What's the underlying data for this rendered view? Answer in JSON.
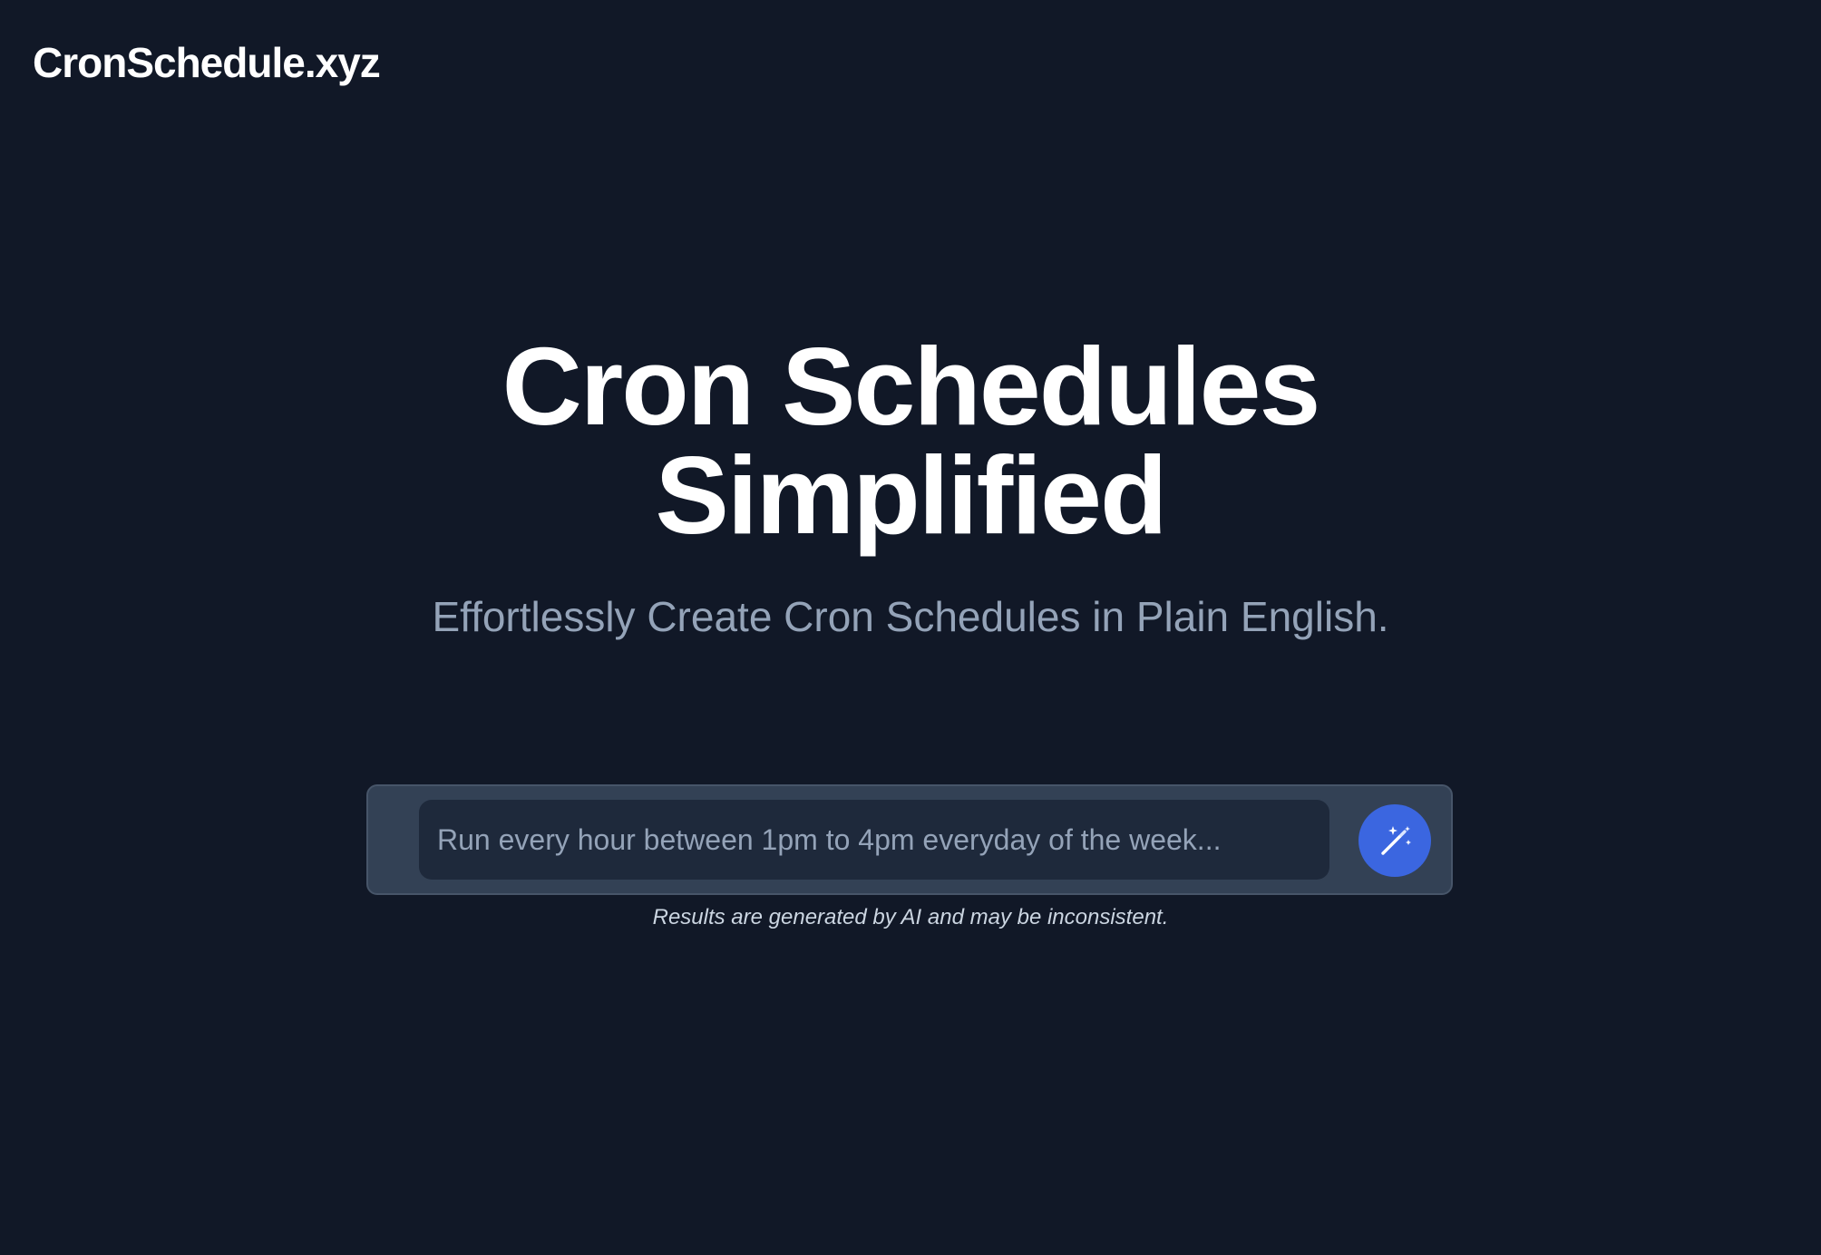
{
  "header": {
    "brand": "CronSchedule.xyz"
  },
  "hero": {
    "title": "Cron Schedules Simplified",
    "subtitle": "Effortlessly Create Cron Schedules in Plain English."
  },
  "prompt": {
    "placeholder": "Run every hour between 1pm to 4pm everyday of the week...",
    "value": "",
    "submit_icon": "magic-wand-icon",
    "disclaimer": "Results are generated by AI and may be inconsistent."
  },
  "colors": {
    "background": "#111827",
    "panel": "#334155",
    "input": "#1e293b",
    "accent": "#3b66e0",
    "muted_text": "#94a3b8"
  }
}
